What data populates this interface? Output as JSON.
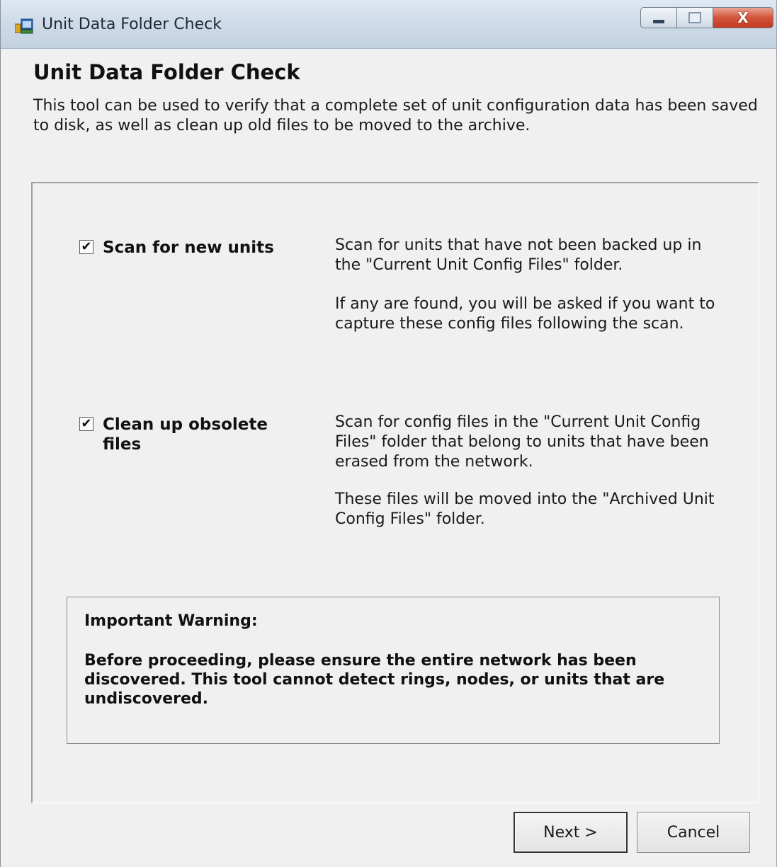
{
  "window": {
    "title": "Unit Data Folder Check",
    "close_glyph": "X"
  },
  "header": {
    "heading": "Unit Data Folder Check",
    "intro": "This tool can be used to verify that a complete set of unit configuration data has been saved to disk, as well as clean up old files to be moved to the archive."
  },
  "options": [
    {
      "label": "Scan for new units",
      "checked": true,
      "description": [
        "Scan for units that have not been backed up in the \"Current Unit Config Files\" folder.",
        "If any are found, you will be asked if you want to capture these config files following the scan."
      ]
    },
    {
      "label": "Clean up obsolete files",
      "checked": true,
      "description": [
        "Scan for config files in the \"Current Unit Config Files\" folder that belong to units that have been erased from the network.",
        "These files will be moved into the \"Archived Unit Config Files\" folder."
      ]
    }
  ],
  "warning": {
    "title": "Important Warning:",
    "body": "Before proceeding, please ensure the entire network has been discovered. This tool cannot detect rings, nodes, or units that are undiscovered."
  },
  "buttons": {
    "next": "Next >",
    "cancel": "Cancel"
  },
  "icons": {
    "app": "app-window-icon",
    "minimize": "minimize-icon",
    "maximize": "maximize-icon",
    "close": "close-icon",
    "checkmark": "✔"
  },
  "colors": {
    "window_bg": "#f0f0f0",
    "titlebar": "#cfdbe8",
    "close_button": "#c8442b"
  }
}
